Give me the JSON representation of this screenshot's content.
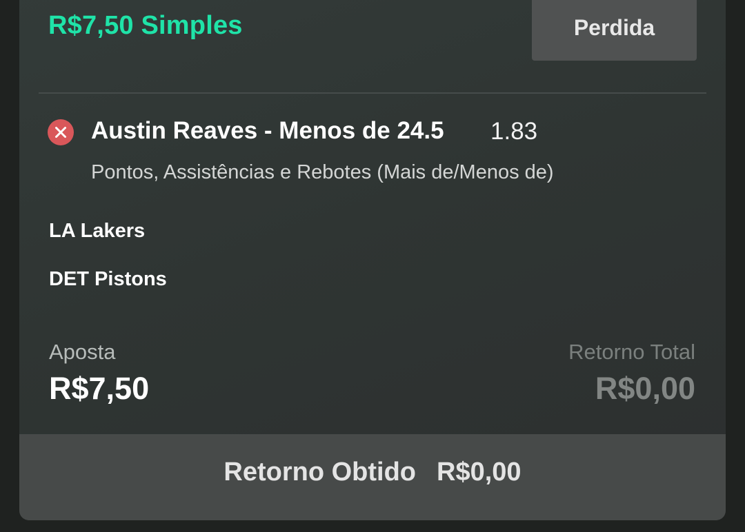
{
  "bet": {
    "title": "R$7,50 Simples",
    "status": "Perdida"
  },
  "selection": {
    "result_icon": "close-icon",
    "name": "Austin Reaves - Menos de 24.5",
    "odds": "1.83",
    "market": "Pontos, Assistências e Rebotes (Mais de/Menos de)"
  },
  "teams": [
    "LA Lakers",
    "DET Pistons"
  ],
  "stake": {
    "label": "Aposta",
    "value": "R$7,50"
  },
  "total_return": {
    "label": "Retorno Total",
    "value": "R$0,00"
  },
  "footer": {
    "label": "Retorno Obtido",
    "value": "R$0,00"
  },
  "colors": {
    "accent": "#1fe3a8",
    "lost": "#d9575a"
  }
}
